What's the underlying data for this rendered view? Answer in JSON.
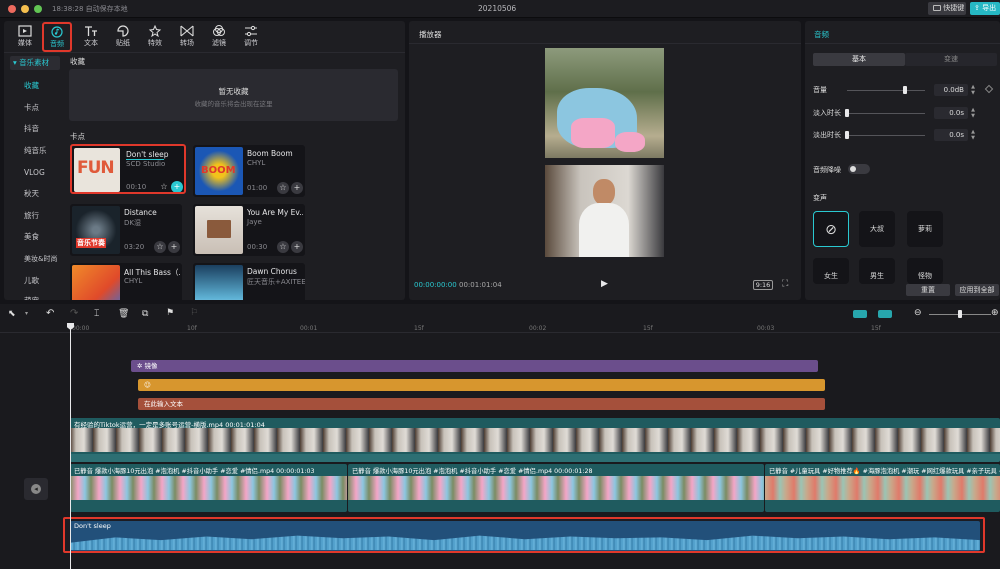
{
  "titlebar": {
    "time_status": "18:38:28 自动保存本地",
    "project_name": "20210506",
    "shortcut_label": "快捷键",
    "export_label": "导出"
  },
  "toolbar": {
    "items": [
      {
        "label": "媒体",
        "icon": "media-icon"
      },
      {
        "label": "音频",
        "icon": "audio-icon"
      },
      {
        "label": "文本",
        "icon": "text-icon"
      },
      {
        "label": "贴纸",
        "icon": "sticker-icon"
      },
      {
        "label": "特效",
        "icon": "effects-icon"
      },
      {
        "label": "转场",
        "icon": "transition-icon"
      },
      {
        "label": "滤镜",
        "icon": "filter-icon"
      },
      {
        "label": "调节",
        "icon": "adjust-icon"
      }
    ]
  },
  "sidebar": {
    "header": "音乐素材",
    "items": [
      "收藏",
      "卡点",
      "抖音",
      "纯音乐",
      "VLOG",
      "秋天",
      "旅行",
      "美食",
      "美妆&时尚",
      "儿歌",
      "萌宠"
    ]
  },
  "library": {
    "favorites_title": "收藏",
    "empty_title": "暂无收藏",
    "empty_sub": "收藏的音乐将会出现在这里",
    "beat_title": "卡点",
    "cards": [
      {
        "title": "Don't sleep",
        "artist": "SCD Studio",
        "duration": "00:10",
        "cover_text": "FUN"
      },
      {
        "title": "Boom Boom",
        "artist": "CHYL",
        "duration": "01:00",
        "cover_text": "BOOM"
      },
      {
        "title": "Distance",
        "artist": "DK湿",
        "duration": "03:20",
        "cover_text": "音乐节奏"
      },
      {
        "title": "You Are My Ev...",
        "artist": "Jaye",
        "duration": "00:30",
        "cover_text": ""
      },
      {
        "title": "All This Bass（...",
        "artist": "CHYL",
        "duration": "",
        "cover_text": ""
      },
      {
        "title": "Dawn Chorus",
        "artist": "匠天音乐+AXITEE",
        "duration": "",
        "cover_text": ""
      }
    ]
  },
  "player": {
    "title": "播放器",
    "current_time": "00:00:00:00",
    "total_time": "00:01:01:04",
    "ratio": "9:16"
  },
  "inspector": {
    "title": "音频",
    "tabs": [
      "基本",
      "变速"
    ],
    "volume_label": "音量",
    "volume_value": "0.0dB",
    "fadein_label": "淡入时长",
    "fadein_value": "0.0s",
    "fadeout_label": "淡出时长",
    "fadeout_value": "0.0s",
    "denoise_label": "音频降噪",
    "voice_label": "变声",
    "voices": [
      "大叔",
      "萝莉",
      "女生",
      "男生",
      "怪物"
    ],
    "reset_label": "重置",
    "apply_all_label": "应用到全部"
  },
  "timeline": {
    "ruler": [
      "00:00",
      "10f",
      "00:01",
      "15f",
      "00:02",
      "15f",
      "00:03",
      "15f"
    ],
    "tracks": {
      "effect": "镜像",
      "sticker": "☺",
      "text": "在此输入文本",
      "main_clip": "有经验的Tiktok运营，一定是多账号运营-横版.mp4   00:01:01:04",
      "pip_clip1": "已静音   爆款小海豚10元出泡  #泡泡机 #抖音小助手 #恋爱 #情侣.mp4   00:00:01:03",
      "pip_clip2": "已静音   爆款小海豚10元出泡  #泡泡机 #抖音小助手 #恋爱 #情侣.mp4   00:00:01:28",
      "pip_clip3": "已静音   #儿童玩具 #好物推荐🔥 #海豚泡泡机 #潮玩 #网红爆款玩具 #亲子玩具 #好物",
      "audio_clip": "Don't sleep"
    }
  },
  "colors": {
    "accent": "#2ac9d1",
    "highlight": "#e0382b",
    "effect_track": "#6b4e8c",
    "sticker_track": "#d7962e",
    "text_track": "#a5503b",
    "main_track": "#1f5b5f",
    "audio_track": "#22507a"
  }
}
